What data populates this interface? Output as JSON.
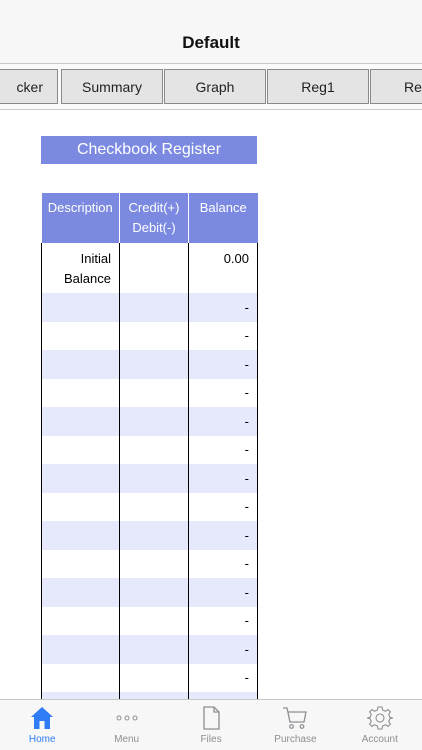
{
  "nav": {
    "title": "Default"
  },
  "sheet_tabs": [
    {
      "label": "cker"
    },
    {
      "label": "Summary"
    },
    {
      "label": "Graph"
    },
    {
      "label": "Reg1"
    },
    {
      "label": "Re"
    }
  ],
  "register": {
    "title": "Checkbook Register",
    "headers": {
      "description": "Description",
      "credit_line1": "Credit(+)",
      "credit_line2": "Debit(-)",
      "balance": "Balance"
    },
    "first_row": {
      "description_line1": "Initial",
      "description_line2": "Balance",
      "credit": "",
      "balance": "0.00"
    },
    "rows": [
      {
        "balance": "-"
      },
      {
        "balance": "-"
      },
      {
        "balance": "-"
      },
      {
        "balance": "-"
      },
      {
        "balance": "-"
      },
      {
        "balance": "-"
      },
      {
        "balance": "-"
      },
      {
        "balance": "-"
      },
      {
        "balance": "-"
      },
      {
        "balance": "-"
      },
      {
        "balance": "-"
      },
      {
        "balance": "-"
      },
      {
        "balance": "-"
      },
      {
        "balance": "-"
      },
      {
        "balance": "-"
      }
    ]
  },
  "tab_bar": {
    "active_color": "#2f7cf6",
    "items": [
      {
        "label": "Home",
        "icon": "home-icon",
        "active": true
      },
      {
        "label": "Menu",
        "icon": "more-icon",
        "active": false
      },
      {
        "label": "Files",
        "icon": "document-icon",
        "active": false
      },
      {
        "label": "Purchase",
        "icon": "cart-icon",
        "active": false
      },
      {
        "label": "Account",
        "icon": "gear-icon",
        "active": false
      }
    ]
  }
}
